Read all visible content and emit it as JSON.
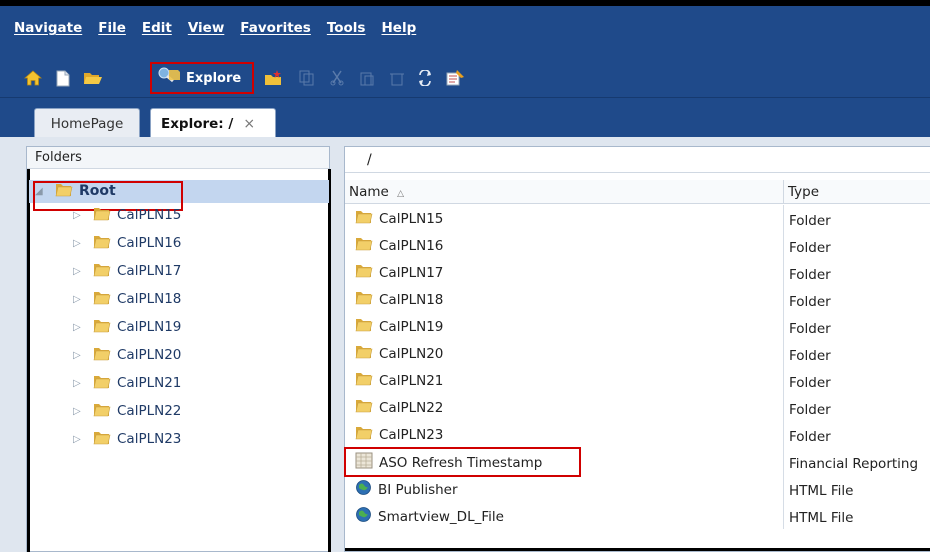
{
  "menubar": {
    "items": [
      {
        "label": "Navigate",
        "name": "menu-navigate"
      },
      {
        "label": "File",
        "name": "menu-file"
      },
      {
        "label": "Edit",
        "name": "menu-edit"
      },
      {
        "label": "View",
        "name": "menu-view"
      },
      {
        "label": "Favorites",
        "name": "menu-favorites"
      },
      {
        "label": "Tools",
        "name": "menu-tools"
      },
      {
        "label": "Help",
        "name": "menu-help"
      }
    ]
  },
  "toolbar": {
    "explore_label": "Explore",
    "icons": [
      "home-icon",
      "new-document-icon",
      "open-folder-icon",
      "explore-icon",
      "new-folder-icon",
      "copy-icon",
      "cut-icon",
      "paste-icon",
      "delete-icon",
      "refresh-icon",
      "properties-icon"
    ]
  },
  "tabs": [
    {
      "label": "HomePage"
    },
    {
      "label": "Explore: /",
      "close": "×"
    }
  ],
  "folders_panel": {
    "header": "Folders",
    "root_label": "Root",
    "items": [
      "CalPLN15",
      "CalPLN16",
      "CalPLN17",
      "CalPLN18",
      "CalPLN19",
      "CalPLN20",
      "CalPLN21",
      "CalPLN22",
      "CalPLN23"
    ]
  },
  "content_panel": {
    "path": "/",
    "columns": {
      "name": "Name",
      "sort": "△",
      "type": "Type"
    },
    "rows": [
      {
        "name": "CalPLN15",
        "type": "Folder",
        "icon": "folder-icon"
      },
      {
        "name": "CalPLN16",
        "type": "Folder",
        "icon": "folder-icon"
      },
      {
        "name": "CalPLN17",
        "type": "Folder",
        "icon": "folder-icon"
      },
      {
        "name": "CalPLN18",
        "type": "Folder",
        "icon": "folder-icon"
      },
      {
        "name": "CalPLN19",
        "type": "Folder",
        "icon": "folder-icon"
      },
      {
        "name": "CalPLN20",
        "type": "Folder",
        "icon": "folder-icon"
      },
      {
        "name": "CalPLN21",
        "type": "Folder",
        "icon": "folder-icon"
      },
      {
        "name": "CalPLN22",
        "type": "Folder",
        "icon": "folder-icon"
      },
      {
        "name": "CalPLN23",
        "type": "Folder",
        "icon": "folder-icon"
      },
      {
        "name": "ASO Refresh Timestamp",
        "type": "Financial Reporting",
        "icon": "report-icon"
      },
      {
        "name": "BI Publisher",
        "type": "HTML File",
        "icon": "globe-icon"
      },
      {
        "name": "Smartview_DL_File",
        "type": "HTML File",
        "icon": "globe-icon"
      }
    ]
  },
  "colors": {
    "header_bg": "#1f4a8a",
    "highlight_box": "#d00000",
    "selection_bg": "#c3d6ef",
    "folder": "#e8c15a"
  }
}
